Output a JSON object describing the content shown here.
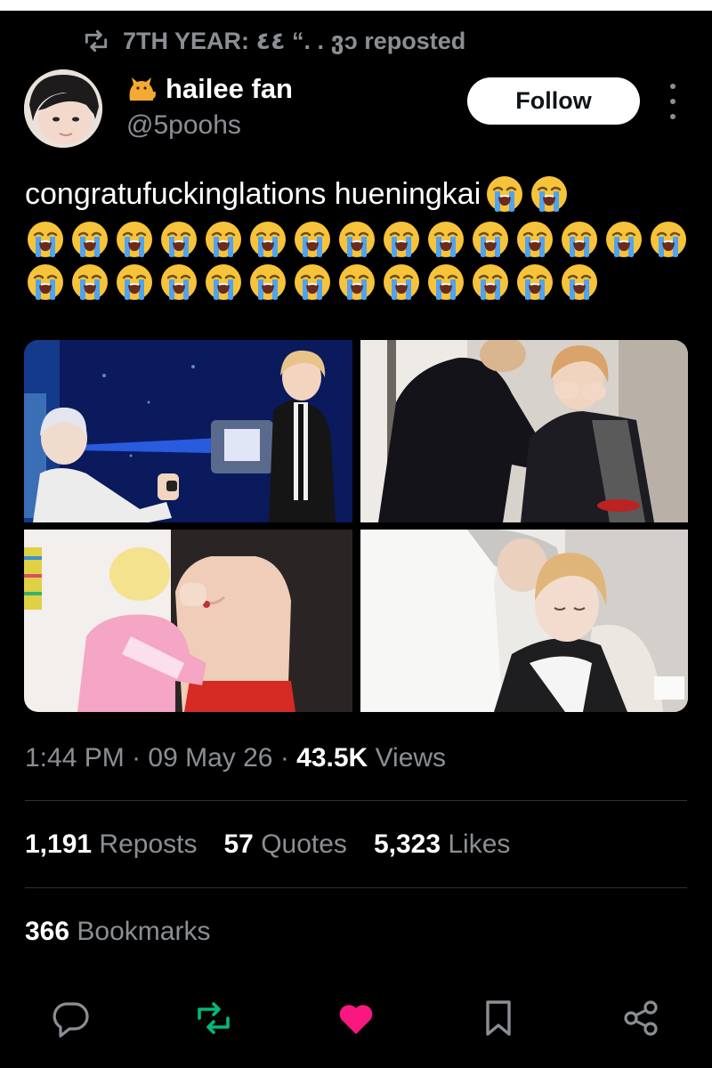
{
  "repost": {
    "text": "7TH YEAR: ٤٤ “. . ვɔ reposted",
    "icon": "repost-icon"
  },
  "author": {
    "emoji": "cat-emoji",
    "name": "hailee fan",
    "handle": "@5poohs",
    "follow_label": "Follow"
  },
  "tweet": {
    "text": "congratufuckinglations hueningkai",
    "emoji": "loudly-crying-face",
    "emoji_counts": [
      2,
      15,
      13
    ]
  },
  "media": {
    "images": [
      {
        "alt": ""
      },
      {
        "alt": ""
      },
      {
        "alt": ""
      },
      {
        "alt": ""
      }
    ]
  },
  "meta": {
    "time": "1:44 PM",
    "date": "09 May 26",
    "views_count": "43.5K",
    "views_label": "Views"
  },
  "stats": {
    "reposts": {
      "count": "1,191",
      "label": "Reposts"
    },
    "quotes": {
      "count": "57",
      "label": "Quotes"
    },
    "likes": {
      "count": "5,323",
      "label": "Likes"
    },
    "bookmarks": {
      "count": "366",
      "label": "Bookmarks"
    }
  },
  "actions": [
    "reply-icon",
    "repost-icon",
    "like-icon",
    "bookmark-icon",
    "share-icon"
  ],
  "colors": {
    "background": "#000000",
    "muted": "#8b8f94",
    "repost_active": "#00ba7c",
    "like_active": "#f91880",
    "follow_bg": "#ffffff"
  }
}
